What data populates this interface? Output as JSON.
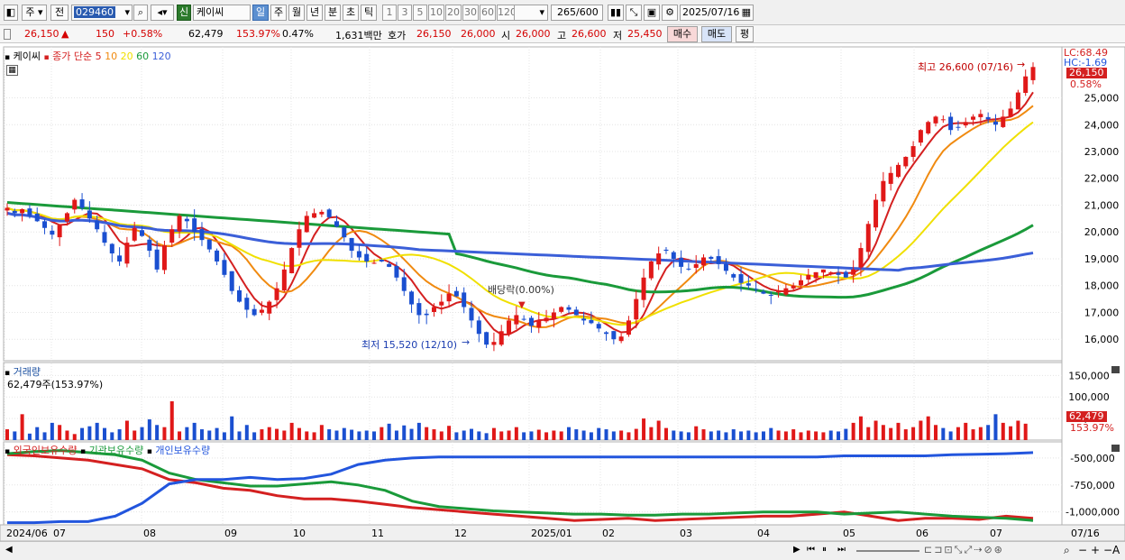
{
  "toolbar": {
    "market": "주",
    "prev": "전",
    "code": "029460",
    "name": "케이씨",
    "credit_badge": "신",
    "periods": [
      "일",
      "주",
      "월",
      "년",
      "분",
      "초",
      "틱"
    ],
    "selected_period": "일",
    "minutes": [
      "1",
      "3",
      "5",
      "10",
      "20",
      "30",
      "60",
      "120"
    ],
    "count": "265",
    "count_max": "/600",
    "date": "2025/07/16"
  },
  "quote": {
    "price": "26,150",
    "arrow": "▲",
    "change": "150",
    "change_pct": "+0.58%",
    "volume": "62,479",
    "volume_ratio": "153.97%",
    "turnover": "0.47%",
    "amount": "1,631백만",
    "ask_label": "호가",
    "ask": "26,150",
    "bid": "26,000",
    "open_label": "시",
    "open": "26,000",
    "high_label": "고",
    "high": "26,600",
    "low_label": "저",
    "low": "25,450",
    "buy_btn": "매수",
    "sell_btn": "매도",
    "avg_btn": "평"
  },
  "price_panel": {
    "legend_name": "케이씨",
    "legend_ma_prefix": "종가 단순",
    "ma_periods": [
      "5",
      "10",
      "20",
      "60",
      "120"
    ],
    "ma_colors": [
      "#d42020",
      "#f08a10",
      "#f0e000",
      "#1a9a3a",
      "#3b5fd8"
    ],
    "lc": "LC:68.49",
    "hc": "HC:-1.69",
    "last_price": "26,150",
    "last_pct": "0.58%",
    "high_annot": "최고 26,600 (07/16)",
    "low_annot": "최저 15,520 (12/10)",
    "dividend_annot": "배당락(0.00%)",
    "y_ticks": [
      "25,000",
      "24,000",
      "23,000",
      "22,000",
      "21,000",
      "20,000",
      "19,000",
      "18,000",
      "17,000",
      "16,000"
    ]
  },
  "volume_panel": {
    "title": "거래량",
    "legend": "62,479주(153.97%)",
    "y_ticks": [
      "150,000",
      "100,000",
      "50,000"
    ],
    "last_vol": "62,479",
    "last_pct": "153.97%"
  },
  "holding_panel": {
    "series": [
      "외국인보유수량",
      "기관보유수량",
      "개인보유수량"
    ],
    "series_colors": [
      "#d42020",
      "#1a9a3a",
      "#2255dd"
    ],
    "y_ticks": [
      "-500,000",
      "-750,000",
      "-1,000,000"
    ]
  },
  "x_axis": {
    "labels": [
      "2024/06",
      "07",
      "08",
      "09",
      "10",
      "11",
      "12",
      "2025/01",
      "02",
      "03",
      "04",
      "05",
      "06",
      "07"
    ],
    "last": "07/16"
  },
  "chart_data": {
    "type": "line",
    "title": "",
    "price_ylim": [
      15200,
      26900
    ],
    "candles_close": [
      20900,
      20700,
      20850,
      20600,
      20400,
      20150,
      19900,
      20250,
      20700,
      21200,
      20900,
      20500,
      20100,
      19600,
      19200,
      18900,
      19600,
      20150,
      19850,
      19300,
      18600,
      19500,
      20100,
      20600,
      20400,
      20000,
      19700,
      19350,
      18900,
      18400,
      17800,
      17400,
      17100,
      16900,
      17100,
      17400,
      17900,
      18600,
      19400,
      20100,
      20600,
      20700,
      20750,
      20550,
      20200,
      19800,
      19300,
      19050,
      18900,
      18850,
      18900,
      18700,
      18300,
      17800,
      17300,
      16900,
      16900,
      17200,
      17400,
      17700,
      17600,
      17200,
      16700,
      16200,
      15800,
      15900,
      16300,
      16700,
      16900,
      16750,
      16500,
      16700,
      16800,
      17000,
      17200,
      17100,
      16900,
      16700,
      16600,
      16400,
      16200,
      16000,
      16100,
      16700,
      17500,
      18300,
      18900,
      19200,
      19300,
      19000,
      18700,
      18600,
      18800,
      19050,
      19000,
      18800,
      18550,
      18300,
      18100,
      18000,
      17850,
      17700,
      17650,
      17800,
      17900,
      18000,
      18200,
      18400,
      18500,
      18600,
      18500,
      18400,
      18300,
      18600,
      19400,
      20300,
      21200,
      21900,
      22200,
      22500,
      22800,
      23200,
      23800,
      24100,
      24300,
      24200,
      23800,
      23900,
      24100,
      24300,
      24400,
      24200,
      24000,
      24300,
      24600,
      25200,
      25800,
      26150
    ],
    "volume": [
      25,
      20,
      60,
      15,
      30,
      18,
      40,
      35,
      22,
      14,
      28,
      32,
      40,
      28,
      18,
      25,
      45,
      22,
      30,
      48,
      35,
      30,
      90,
      20,
      30,
      40,
      25,
      22,
      28,
      18,
      55,
      20,
      35,
      18,
      25,
      30,
      26,
      22,
      40,
      28,
      20,
      18,
      35,
      25,
      22,
      28,
      24,
      20,
      22,
      20,
      30,
      38,
      22,
      34,
      26,
      40,
      30,
      25,
      20,
      33,
      18,
      22,
      26,
      20,
      16,
      28,
      20,
      22,
      30,
      18,
      20,
      24,
      18,
      22,
      20,
      30,
      25,
      22,
      18,
      28,
      25,
      20,
      22,
      18,
      26,
      50,
      30,
      45,
      28,
      22,
      20,
      18,
      32,
      25,
      20,
      22,
      18,
      25,
      20,
      22,
      18,
      20,
      28,
      22,
      20,
      25,
      18,
      22,
      20,
      18,
      22,
      20,
      26,
      40,
      55,
      30,
      45,
      35,
      28,
      40,
      25,
      30,
      45,
      55,
      35,
      28,
      20,
      30,
      40,
      25,
      30,
      35,
      60,
      40,
      32,
      45,
      38
    ],
    "foreign_hold_k": [
      -470,
      -480,
      -500,
      -520,
      -560,
      -600,
      -700,
      -730,
      -780,
      -800,
      -850,
      -880,
      -880,
      -900,
      -930,
      -960,
      -980,
      -1000,
      -1020,
      -1040,
      -1060,
      -1080,
      -1070,
      -1060,
      -1080,
      -1070,
      -1060,
      -1050,
      -1040,
      -1040,
      -1020,
      -1000,
      -1040,
      -1080,
      -1060,
      -1060,
      -1070,
      -1040,
      -1060
    ],
    "inst_hold_k": [
      -460,
      -440,
      -430,
      -450,
      -470,
      -520,
      -640,
      -700,
      -730,
      -760,
      -760,
      -740,
      -720,
      -750,
      -800,
      -900,
      -950,
      -970,
      -990,
      -1000,
      -1010,
      -1020,
      -1020,
      -1030,
      -1030,
      -1020,
      -1020,
      -1010,
      -1000,
      -1000,
      -1000,
      -1020,
      -1010,
      -1000,
      -1020,
      -1040,
      -1050,
      -1060,
      -1080
    ],
    "indiv_hold_k": [
      -1100,
      -1100,
      -1090,
      -1090,
      -1040,
      -920,
      -740,
      -700,
      -700,
      -680,
      -700,
      -690,
      -650,
      -560,
      -520,
      -500,
      -490,
      -490,
      -490,
      -490,
      -490,
      -490,
      -490,
      -490,
      -490,
      -490,
      -490,
      -490,
      -490,
      -490,
      -490,
      -480,
      -480,
      -480,
      -480,
      -470,
      -465,
      -460,
      -450
    ],
    "holding_ylim": [
      -1120,
      -350
    ]
  }
}
